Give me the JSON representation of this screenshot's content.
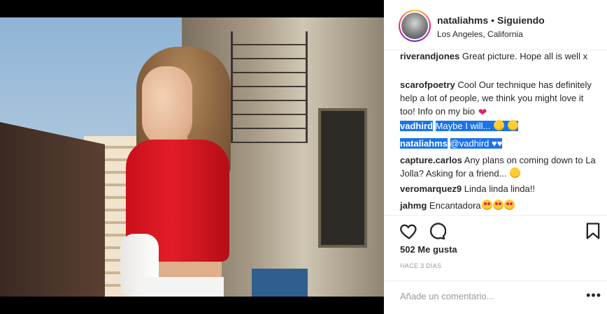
{
  "post": {
    "username": "nataliahms",
    "separator": "•",
    "follow_status": "Siguiendo",
    "location": "Los Angeles, California",
    "likes": "502 Me gusta",
    "time_ago": "HACE 3 DÍAS",
    "add_comment_placeholder": "Añade un comentario...",
    "more_options": "•••"
  },
  "comments": [
    {
      "user": "riverandjones",
      "text": "Great picture. Hope all is well x",
      "emojis": []
    },
    {
      "user": "scarofpoetry",
      "text": "Cool Our technique has definitely help a lot of people, we think you might love it too! Info on my bio",
      "emojis": [
        "heart"
      ]
    },
    {
      "user": "vadhird",
      "text": "Maybe I will...",
      "emojis": [
        "smile",
        "smile"
      ],
      "selected": true
    },
    {
      "user": "nataliahms",
      "text": "@vadhird ♥♥",
      "emojis": [],
      "selected": true
    },
    {
      "user": "capture.carlos",
      "text": "Any plans on coming down to La Jolla? Asking for a friend...",
      "emojis": [
        "sweat"
      ]
    },
    {
      "user": "veromarquez9",
      "text": "Linda linda linda!!",
      "emojis": []
    },
    {
      "user": "jahmg",
      "text": "Encantadora",
      "emojis": [
        "heart-eyes",
        "heart-eyes",
        "heart-eyes"
      ]
    }
  ],
  "icons": {
    "like": "heart-icon",
    "comment": "comment-icon",
    "save": "bookmark-icon"
  },
  "colors": {
    "selection": "#1a73e8",
    "text": "#262626",
    "muted": "#999999"
  }
}
